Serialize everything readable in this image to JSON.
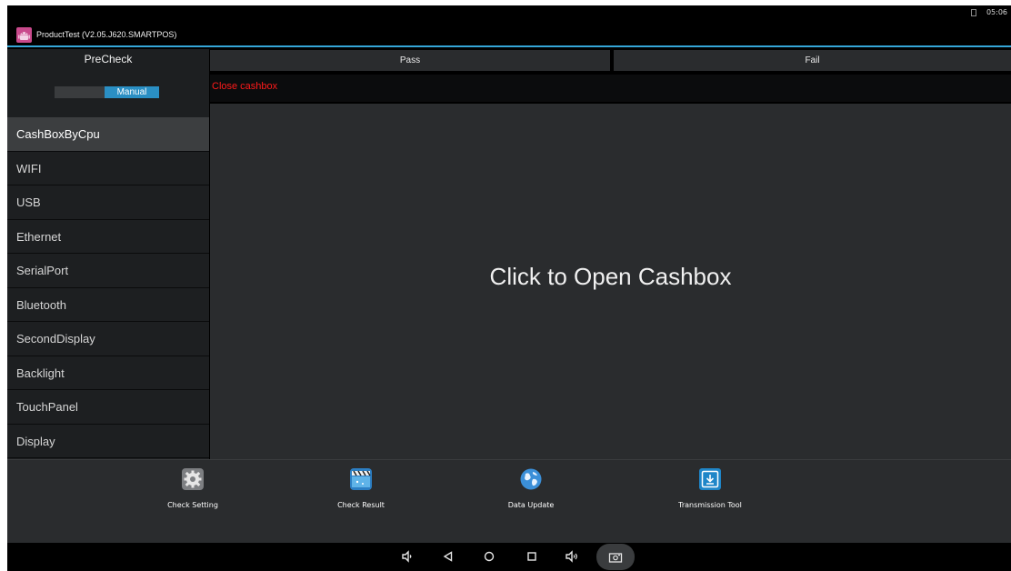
{
  "status": {
    "time": "05:06"
  },
  "titlebar": {
    "title": "ProductTest (V2.05.J620.SMARTPOS)",
    "icon": "android-robot-icon"
  },
  "sidebar": {
    "heading": "PreCheck",
    "mode_label": "Manual",
    "items": [
      {
        "label": "CashBoxByCpu",
        "active": true
      },
      {
        "label": "WIFI"
      },
      {
        "label": "USB"
      },
      {
        "label": "Ethernet"
      },
      {
        "label": "SerialPort"
      },
      {
        "label": "Bluetooth"
      },
      {
        "label": "SecondDisplay"
      },
      {
        "label": "Backlight"
      },
      {
        "label": "TouchPanel"
      },
      {
        "label": "Display"
      }
    ]
  },
  "main": {
    "pass_label": "Pass",
    "fail_label": "Fail",
    "message": "Close cashbox",
    "center_text": "Click to Open Cashbox"
  },
  "toolbar": {
    "tools": [
      {
        "label": "Check Setting",
        "icon": "gear-icon"
      },
      {
        "label": "Check Result",
        "icon": "clapperboard-icon"
      },
      {
        "label": "Data Update",
        "icon": "globe-icon"
      },
      {
        "label": "Transmission Tool",
        "icon": "download-box-icon"
      }
    ]
  },
  "navbar": {
    "buttons": [
      "volume-down-icon",
      "back-icon",
      "home-icon",
      "recents-icon",
      "volume-up-icon",
      "screenshot-icon"
    ]
  },
  "colors": {
    "accent": "#35a6d8",
    "toggle": "#2a8fc4",
    "error_text": "#ff1a1a",
    "panel": "#2a2c2e",
    "sidebar": "#1d1f21"
  }
}
